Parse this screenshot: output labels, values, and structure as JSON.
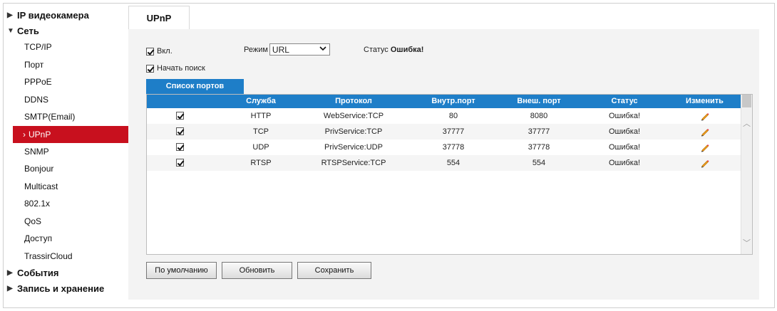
{
  "sidebar": {
    "groups": [
      {
        "label": "IP видеокамера"
      },
      {
        "label": "Сеть"
      },
      {
        "label": "События"
      },
      {
        "label": "Запись и хранение"
      }
    ],
    "items": [
      {
        "label": "TCP/IP"
      },
      {
        "label": "Порт"
      },
      {
        "label": "PPPoE"
      },
      {
        "label": "DDNS"
      },
      {
        "label": "SMTP(Email)"
      },
      {
        "label": "UPnP"
      },
      {
        "label": "SNMP"
      },
      {
        "label": "Bonjour"
      },
      {
        "label": "Multicast"
      },
      {
        "label": "802.1x"
      },
      {
        "label": "QoS"
      },
      {
        "label": "Доступ"
      },
      {
        "label": "TrassirCloud"
      }
    ],
    "active_color": "#c8101e"
  },
  "tab": {
    "label": "UPnP"
  },
  "settings": {
    "enable_label": "Вкл.",
    "enable_checked": true,
    "mode_label": "Режим",
    "mode_value": "URL",
    "status_label": "Статус",
    "status_value": "Ошибка!",
    "search_label": "Начать поиск",
    "search_checked": true
  },
  "ports": {
    "subtab_label": "Список портов",
    "headers": [
      "Служба",
      "Протокол",
      "Внутр.порт",
      "Внеш. порт",
      "Статус",
      "Изменить"
    ],
    "rows": [
      {
        "checked": true,
        "service": "HTTP",
        "protocol": "WebService:TCP",
        "internal": "80",
        "external": "8080",
        "status": "Ошибка!",
        "edit_icon": "pencil-icon"
      },
      {
        "checked": true,
        "service": "TCP",
        "protocol": "PrivService:TCP",
        "internal": "37777",
        "external": "37777",
        "status": "Ошибка!",
        "edit_icon": "pencil-icon"
      },
      {
        "checked": true,
        "service": "UDP",
        "protocol": "PrivService:UDP",
        "internal": "37778",
        "external": "37778",
        "status": "Ошибка!",
        "edit_icon": "pencil-icon"
      },
      {
        "checked": true,
        "service": "RTSP",
        "protocol": "RTSPService:TCP",
        "internal": "554",
        "external": "554",
        "status": "Ошибка!",
        "edit_icon": "pencil-icon"
      }
    ],
    "header_color": "#1e7ec8"
  },
  "buttons": {
    "default_label": "По умолчанию",
    "refresh_label": "Обновить",
    "save_label": "Сохранить"
  }
}
